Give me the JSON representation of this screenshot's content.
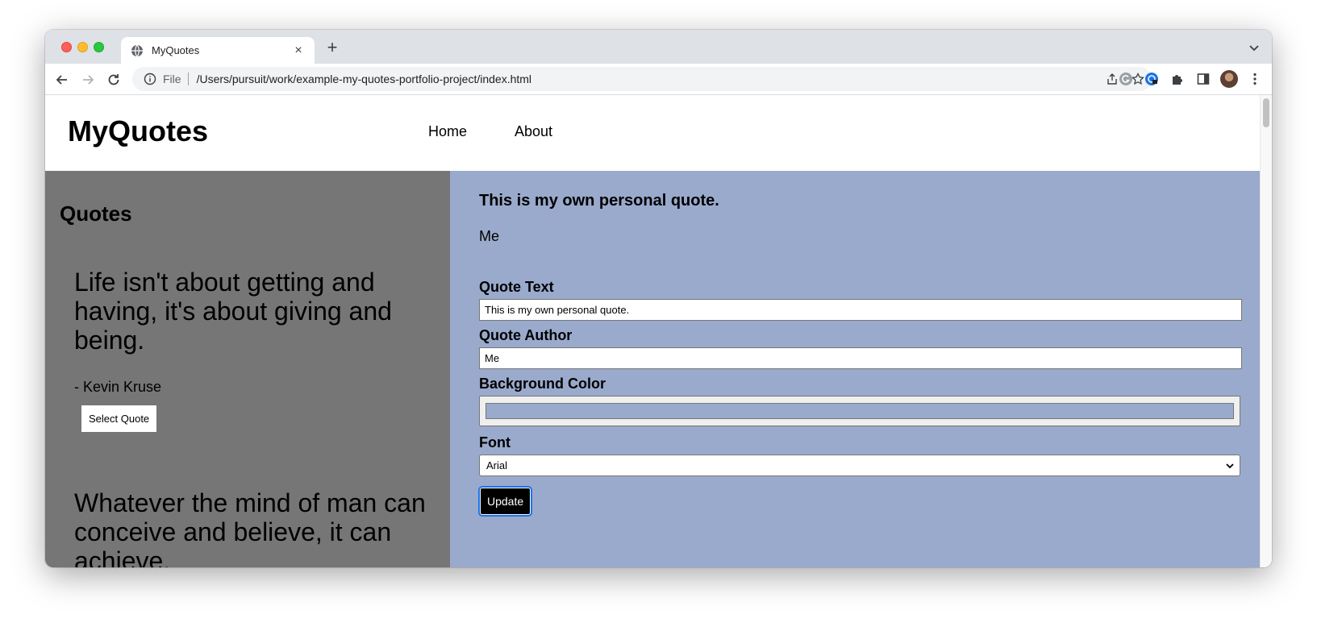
{
  "browser": {
    "tab_title": "MyQuotes",
    "tab_close": "×",
    "new_tab": "+",
    "omnibox_scheme": "File",
    "url": "/Users/pursuit/work/example-my-quotes-portfolio-project/index.html"
  },
  "site": {
    "logo": "MyQuotes",
    "nav": [
      {
        "label": "Home"
      },
      {
        "label": "About"
      }
    ]
  },
  "quotes_panel": {
    "heading": "Quotes",
    "quotes": [
      {
        "text": "Life isn't about getting and having, it's about giving and being.",
        "author": "- Kevin Kruse",
        "button": "Select Quote"
      },
      {
        "text": "Whatever the mind of man can conceive and believe, it can achieve."
      }
    ]
  },
  "editor": {
    "preview_quote": "This is my own personal quote.",
    "preview_author": "Me",
    "fields": {
      "quote_text_label": "Quote Text",
      "quote_text_value": "This is my own personal quote.",
      "quote_author_label": "Quote Author",
      "quote_author_value": "Me",
      "background_color_label": "Background Color",
      "background_color_value": "#9aaacc",
      "font_label": "Font",
      "font_value": "Arial"
    },
    "update_button": "Update"
  }
}
